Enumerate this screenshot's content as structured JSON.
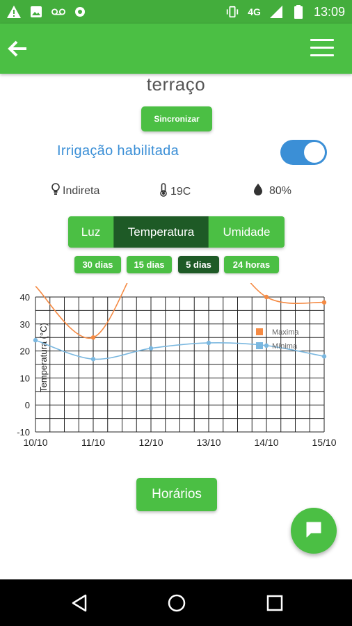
{
  "status_bar": {
    "network": "4G",
    "time": "13:09",
    "icons": [
      "warning-icon",
      "image-icon",
      "voicemail-icon",
      "weather-icon",
      "vibrate-icon",
      "signal-icon",
      "battery-icon"
    ]
  },
  "app_bar": {
    "back_icon": "arrow-left-icon",
    "menu_icon": "hamburger-menu-icon"
  },
  "page": {
    "title": "terraço",
    "sync_label": "Sincronizar"
  },
  "irrigation": {
    "label": "Irrigação habilitada",
    "enabled": true
  },
  "conditions": {
    "light": "Indireta",
    "temperature": "19C",
    "humidity": "80%"
  },
  "tabs": [
    {
      "label": "Luz",
      "active": false
    },
    {
      "label": "Temperatura",
      "active": true
    },
    {
      "label": "Umidade",
      "active": false
    }
  ],
  "ranges": [
    {
      "label": "30 dias",
      "active": false
    },
    {
      "label": "15 dias",
      "active": false
    },
    {
      "label": "5 dias",
      "active": true
    },
    {
      "label": "24 horas",
      "active": false
    }
  ],
  "chart_data": {
    "type": "line",
    "ylabel": "Temperatura (°C)",
    "ylim": [
      -10,
      40
    ],
    "yticks": [
      "40",
      "30",
      "20",
      "10",
      "0",
      "-10"
    ],
    "categories": [
      "10/10",
      "11/10",
      "12/10",
      "13/10",
      "14/10",
      "15/10"
    ],
    "series": [
      {
        "name": "Máxima",
        "color": "#f58a43",
        "values": [
          44,
          25,
          60,
          62,
          40,
          38
        ]
      },
      {
        "name": "Mínima",
        "color": "#7bb8e0",
        "values": [
          24,
          17,
          21,
          23,
          22,
          18
        ]
      }
    ],
    "legend_position": "right"
  },
  "actions": {
    "schedule_label": "Horários",
    "chat_icon": "chat-bubble-icon"
  },
  "nav": {
    "back": "nav-back-icon",
    "home": "nav-home-icon",
    "recents": "nav-recents-icon"
  }
}
